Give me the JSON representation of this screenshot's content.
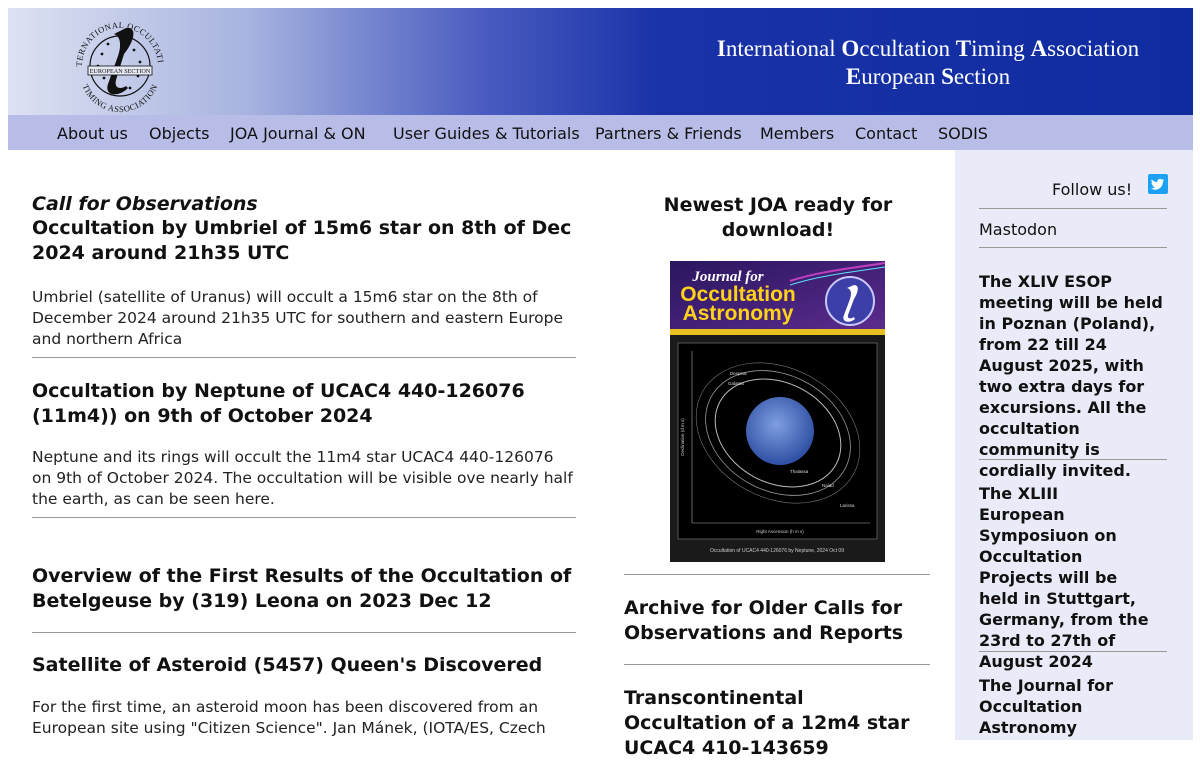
{
  "header": {
    "title_line1": [
      {
        "cap": "I",
        "rest": "nternational "
      },
      {
        "cap": "O",
        "rest": "ccultation "
      },
      {
        "cap": "T",
        "rest": "iming "
      },
      {
        "cap": "A",
        "rest": "ssociation"
      }
    ],
    "title_line2": [
      {
        "cap": "E",
        "rest": "uropean "
      },
      {
        "cap": "S",
        "rest": "ection"
      }
    ],
    "logo": {
      "icon": "iota-es-seal",
      "ring_text_top": "INTERNATIONAL OCCULTATION",
      "ring_text_bottom": "TIMING ASSOCIATION",
      "band_text": "EUROPEAN SECTION",
      "letter": "I"
    }
  },
  "nav": {
    "items": [
      "About us",
      "Objects",
      "JOA Journal & ON",
      "User Guides & Tutorials",
      "Partners & Friends",
      "Members",
      "Contact",
      "SODIS"
    ]
  },
  "main": {
    "kicker": "Call for Observations",
    "articles": [
      {
        "title": "Occultation by Umbriel of 15m6 star on 8th of Dec 2024 around 21h35 UTC",
        "body": "Umbriel (satellite of Uranus) will occult a 15m6 star on the 8th of December 2024 around 21h35 UTC for southern and eastern Europe and northern Africa"
      },
      {
        "title": "Occultation by Neptune of UCAC4 440-126076 (11m4)) on 9th of October 2024",
        "body": "Neptune and its rings will occult the 11m4 star UCAC4 440-126076 on 9th of October 2024. The occultation will be visible ove nearly half the earth, as can be seen here."
      },
      {
        "title": "Overview of the First Results of the Occultation of Betelgeuse by (319) Leona on 2023 Dec 12",
        "body": ""
      },
      {
        "title": "Satellite of Asteroid (5457) Queen's Discovered",
        "body": "For the first time, an asteroid moon has been discovered from an European site using \"Citizen Science\". Jan Mánek, (IOTA/ES, Czech"
      }
    ]
  },
  "middle": {
    "joa_heading": "Newest JOA ready for download!",
    "cover": {
      "title_line1": "Journal for",
      "title_line2": "Occultation",
      "title_line3": "Astronomy",
      "caption": "Occultation of UCAC4 440-126076 by Neptune, 2024 Oct 09",
      "x_axis_label": "Right Ascension (h m s)",
      "y_axis_label": "Declination (d m s)",
      "moon_labels": [
        "Despina",
        "Galatea",
        "Thalassa",
        "Naiad",
        "Larissa"
      ]
    },
    "links": [
      "Archive for Older Calls for Observations and Reports",
      "Transcontinental Occultation of a 12m4 star UCAC4 410-143659"
    ]
  },
  "sidebar": {
    "follow_label": "Follow us!",
    "social_icon": "twitter-bird-icon",
    "mastodon_label": "Mastodon",
    "news": [
      "The XLIV ESOP meeting will be held in Poznan (Poland), from 22 till 24 August 2025, with two extra days for excursions. All the occultation community is cordially invited.",
      "The XLIII European Symposiuon on Occultation Projects will be held in Stuttgart, Germany, from the 23rd to 27th of August 2024",
      "The Journal for Occultation Astronomy"
    ]
  },
  "colors": {
    "header_dark": "#0f2ba0",
    "nav_bg": "#b7bde6",
    "sidebar_bg": "#eaebf8",
    "twitter": "#1da1f2"
  }
}
